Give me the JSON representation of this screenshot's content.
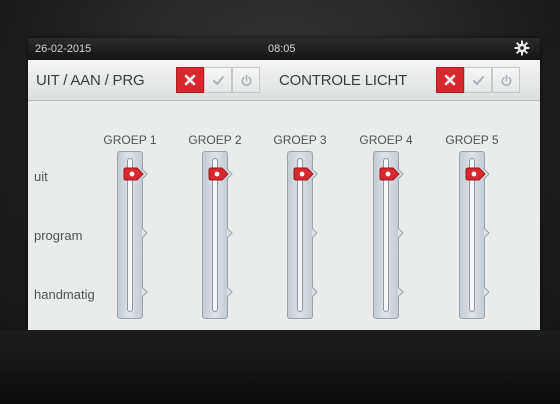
{
  "status": {
    "date": "26-02-2015",
    "time": "08:05",
    "settings_icon": "gear-icon"
  },
  "toolbar": {
    "left_label": "UIT / AAN / PRG",
    "right_label": "CONTROLE LICHT",
    "buttons": [
      {
        "icon": "close-icon",
        "state": "active",
        "color": "#d8282e"
      },
      {
        "icon": "check-icon",
        "state": "inactive"
      },
      {
        "icon": "power-icon",
        "state": "inactive"
      }
    ]
  },
  "rows": [
    "uit",
    "program",
    "handmatig"
  ],
  "groups": [
    {
      "label": "GROEP 1",
      "position": "uit"
    },
    {
      "label": "GROEP 2",
      "position": "uit"
    },
    {
      "label": "GROEP 3",
      "position": "uit"
    },
    {
      "label": "GROEP 4",
      "position": "uit"
    },
    {
      "label": "GROEP 5",
      "position": "uit"
    }
  ],
  "colors": {
    "accent_red": "#d8282e",
    "screen_bg": "#e9ecea",
    "statusbar_bg": "#1b1b1b"
  }
}
